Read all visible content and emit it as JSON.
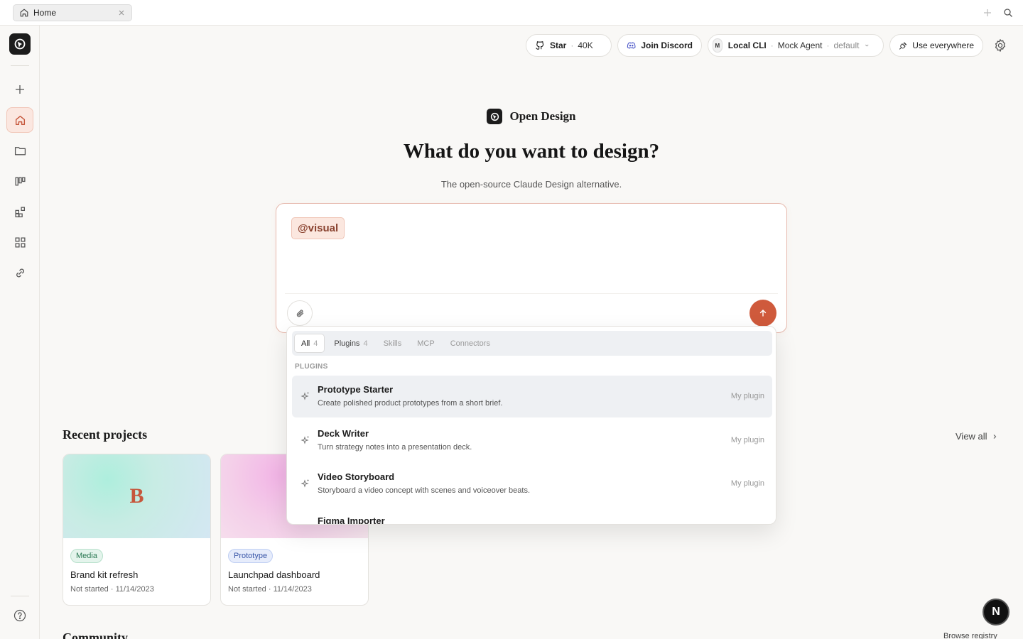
{
  "topbar": {
    "tab_label": "Home"
  },
  "header": {
    "star_label": "Star",
    "star_count": "40K",
    "discord_label": "Join Discord",
    "agent_badge": "M",
    "agent_source": "Local CLI",
    "agent_name": "Mock Agent",
    "agent_mode": "default",
    "use_everywhere_label": "Use everywhere"
  },
  "hero": {
    "brand_name": "Open Design",
    "title": "What do you want to design?",
    "subtitle": "The open-source Claude Design alternative."
  },
  "composer": {
    "mention": "@visual"
  },
  "dropdown": {
    "tabs": [
      {
        "label": "All",
        "count": "4"
      },
      {
        "label": "Plugins",
        "count": "4"
      },
      {
        "label": "Skills",
        "count": ""
      },
      {
        "label": "MCP",
        "count": ""
      },
      {
        "label": "Connectors",
        "count": ""
      }
    ],
    "section_label": "PLUGINS",
    "items": [
      {
        "name": "Prototype Starter",
        "desc": "Create polished product prototypes from a short brief.",
        "tag": "My plugin"
      },
      {
        "name": "Deck Writer",
        "desc": "Turn strategy notes into a presentation deck.",
        "tag": "My plugin"
      },
      {
        "name": "Video Storyboard",
        "desc": "Storyboard a video concept with scenes and voiceover beats.",
        "tag": "My plugin"
      },
      {
        "name": "Figma Importer",
        "desc": "",
        "tag": ""
      }
    ]
  },
  "recent": {
    "title": "Recent projects",
    "view_all": "View all",
    "projects": [
      {
        "initial": "B",
        "badge": "Media",
        "name": "Brand kit refresh",
        "meta": "Not started · 11/14/2023"
      },
      {
        "initial": "",
        "badge": "Prototype",
        "name": "Launchpad dashboard",
        "meta": "Not started · 11/14/2023"
      }
    ]
  },
  "community": {
    "title": "Community",
    "browse": "Browse registry"
  },
  "floating": {
    "n_label": "N"
  },
  "colors": {
    "accent": "#cf5a3c",
    "accent_soft": "#fbe7df",
    "background": "#f9f8f6"
  }
}
